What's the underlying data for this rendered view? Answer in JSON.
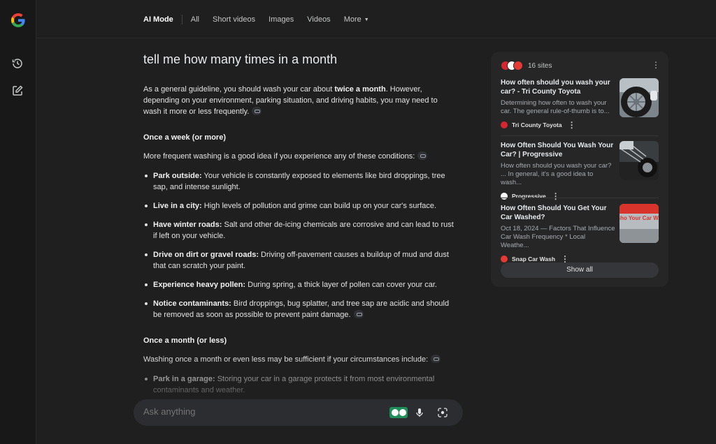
{
  "nav": {
    "tabs": [
      {
        "label": "AI Mode"
      },
      {
        "label": "All"
      },
      {
        "label": "Short videos"
      },
      {
        "label": "Images"
      },
      {
        "label": "Videos"
      },
      {
        "label": "More"
      }
    ]
  },
  "query": "tell me how many times in a month",
  "answer": {
    "intro_pre": "As a general guideline, you should wash your car about ",
    "intro_bold": "twice a month",
    "intro_post": ". However, depending on your environment, parking situation, and driving habits, you may need to wash it more or less frequently.",
    "section1": {
      "heading": "Once a week (or more)",
      "lead": "More frequent washing is a good idea if you experience any of these conditions:",
      "items": [
        {
          "bold": "Park outside:",
          "text": " Your vehicle is constantly exposed to elements like bird droppings, tree sap, and intense sunlight."
        },
        {
          "bold": "Live in a city:",
          "text": " High levels of pollution and grime can build up on your car's surface."
        },
        {
          "bold": "Have winter roads:",
          "text": " Salt and other de-icing chemicals are corrosive and can lead to rust if left on your vehicle."
        },
        {
          "bold": "Drive on dirt or gravel roads:",
          "text": " Driving off-pavement causes a buildup of mud and dust that can scratch your paint."
        },
        {
          "bold": "Experience heavy pollen:",
          "text": " During spring, a thick layer of pollen can cover your car."
        },
        {
          "bold": "Notice contaminants:",
          "text": " Bird droppings, bug splatter, and tree sap are acidic and should be removed as soon as possible to prevent paint damage."
        }
      ]
    },
    "section2": {
      "heading": "Once a month (or less)",
      "lead": "Washing once a month or even less may be sufficient if your circumstances include:",
      "items": [
        {
          "bold": "Park in a garage:",
          "text": " Storing your car in a garage protects it from most environmental contaminants and weather."
        }
      ]
    }
  },
  "ask": {
    "placeholder": "Ask anything"
  },
  "sources": {
    "count_label": "16 sites",
    "cards": [
      {
        "title": "How often should you wash your car? - Tri County Toyota",
        "snippet": "Determining how often to wash your car. The general rule-of-thumb is to...",
        "site": "Tri County Toyota",
        "fav_color": "#d6262f"
      },
      {
        "title": "How Often Should You Wash Your Car? | Progressive",
        "snippet": "How often should you wash your car? ... In general, it's a good idea to wash...",
        "site": "Progressive",
        "fav_color": "#ffffff"
      },
      {
        "title": "How Often Should You Get Your Car Washed?",
        "snippet": "Oct 18, 2024 — Factors That Influence Car Wash Frequency * Local Weathe...",
        "site": "Snap Car Wash",
        "fav_color": "#e53935"
      }
    ],
    "show_all_label": "Show all"
  },
  "thumb3_text": "Often Sho Your Car Washed?"
}
